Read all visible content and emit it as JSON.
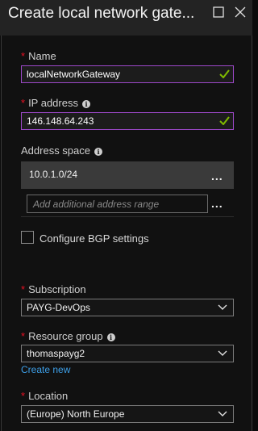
{
  "window": {
    "title": "Create local network gate...",
    "maximize_icon": "square-icon",
    "close_icon": "close-icon"
  },
  "form": {
    "required_marker": "*",
    "name": {
      "label": "Name",
      "value": "localNetworkGateway",
      "valid_icon": "check-icon"
    },
    "ip_address": {
      "label": "IP address",
      "value": "146.148.64.243",
      "valid_icon": "check-icon",
      "info_icon": "info-icon"
    },
    "address_space": {
      "label": "Address space",
      "info_icon": "info-icon",
      "entries": [
        "10.0.1.0/24"
      ],
      "more_label": "...",
      "add_placeholder": "Add additional address range"
    },
    "bgp": {
      "label": "Configure BGP settings",
      "checked": false
    },
    "subscription": {
      "label": "Subscription",
      "value": "PAYG-DevOps"
    },
    "resource_group": {
      "label": "Resource group",
      "info_icon": "info-icon",
      "value": "thomaspayg2",
      "create_new": "Create new"
    },
    "location": {
      "label": "Location",
      "value": "(Europe) North Europe"
    }
  },
  "colors": {
    "accent_border": "#9c48c8",
    "valid_check": "#7fba00",
    "required": "#e81123",
    "link": "#3d9ee6"
  }
}
